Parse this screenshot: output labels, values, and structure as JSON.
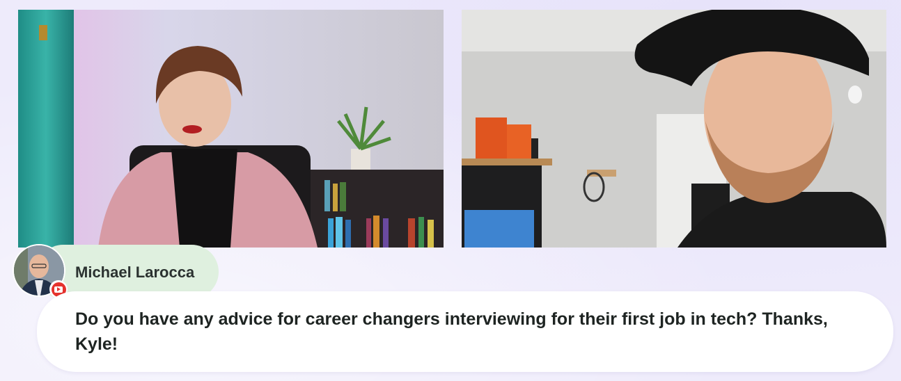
{
  "comment": {
    "author": "Michael Larocca",
    "platform_icon": "youtube-icon",
    "message": "Do you have any advice for career changers interviewing for their first job in tech? Thanks, Kyle!"
  },
  "colors": {
    "background": "#eeebfb",
    "name_pill": "#dff0df",
    "bubble": "#ffffff",
    "youtube_red": "#e5322d"
  }
}
